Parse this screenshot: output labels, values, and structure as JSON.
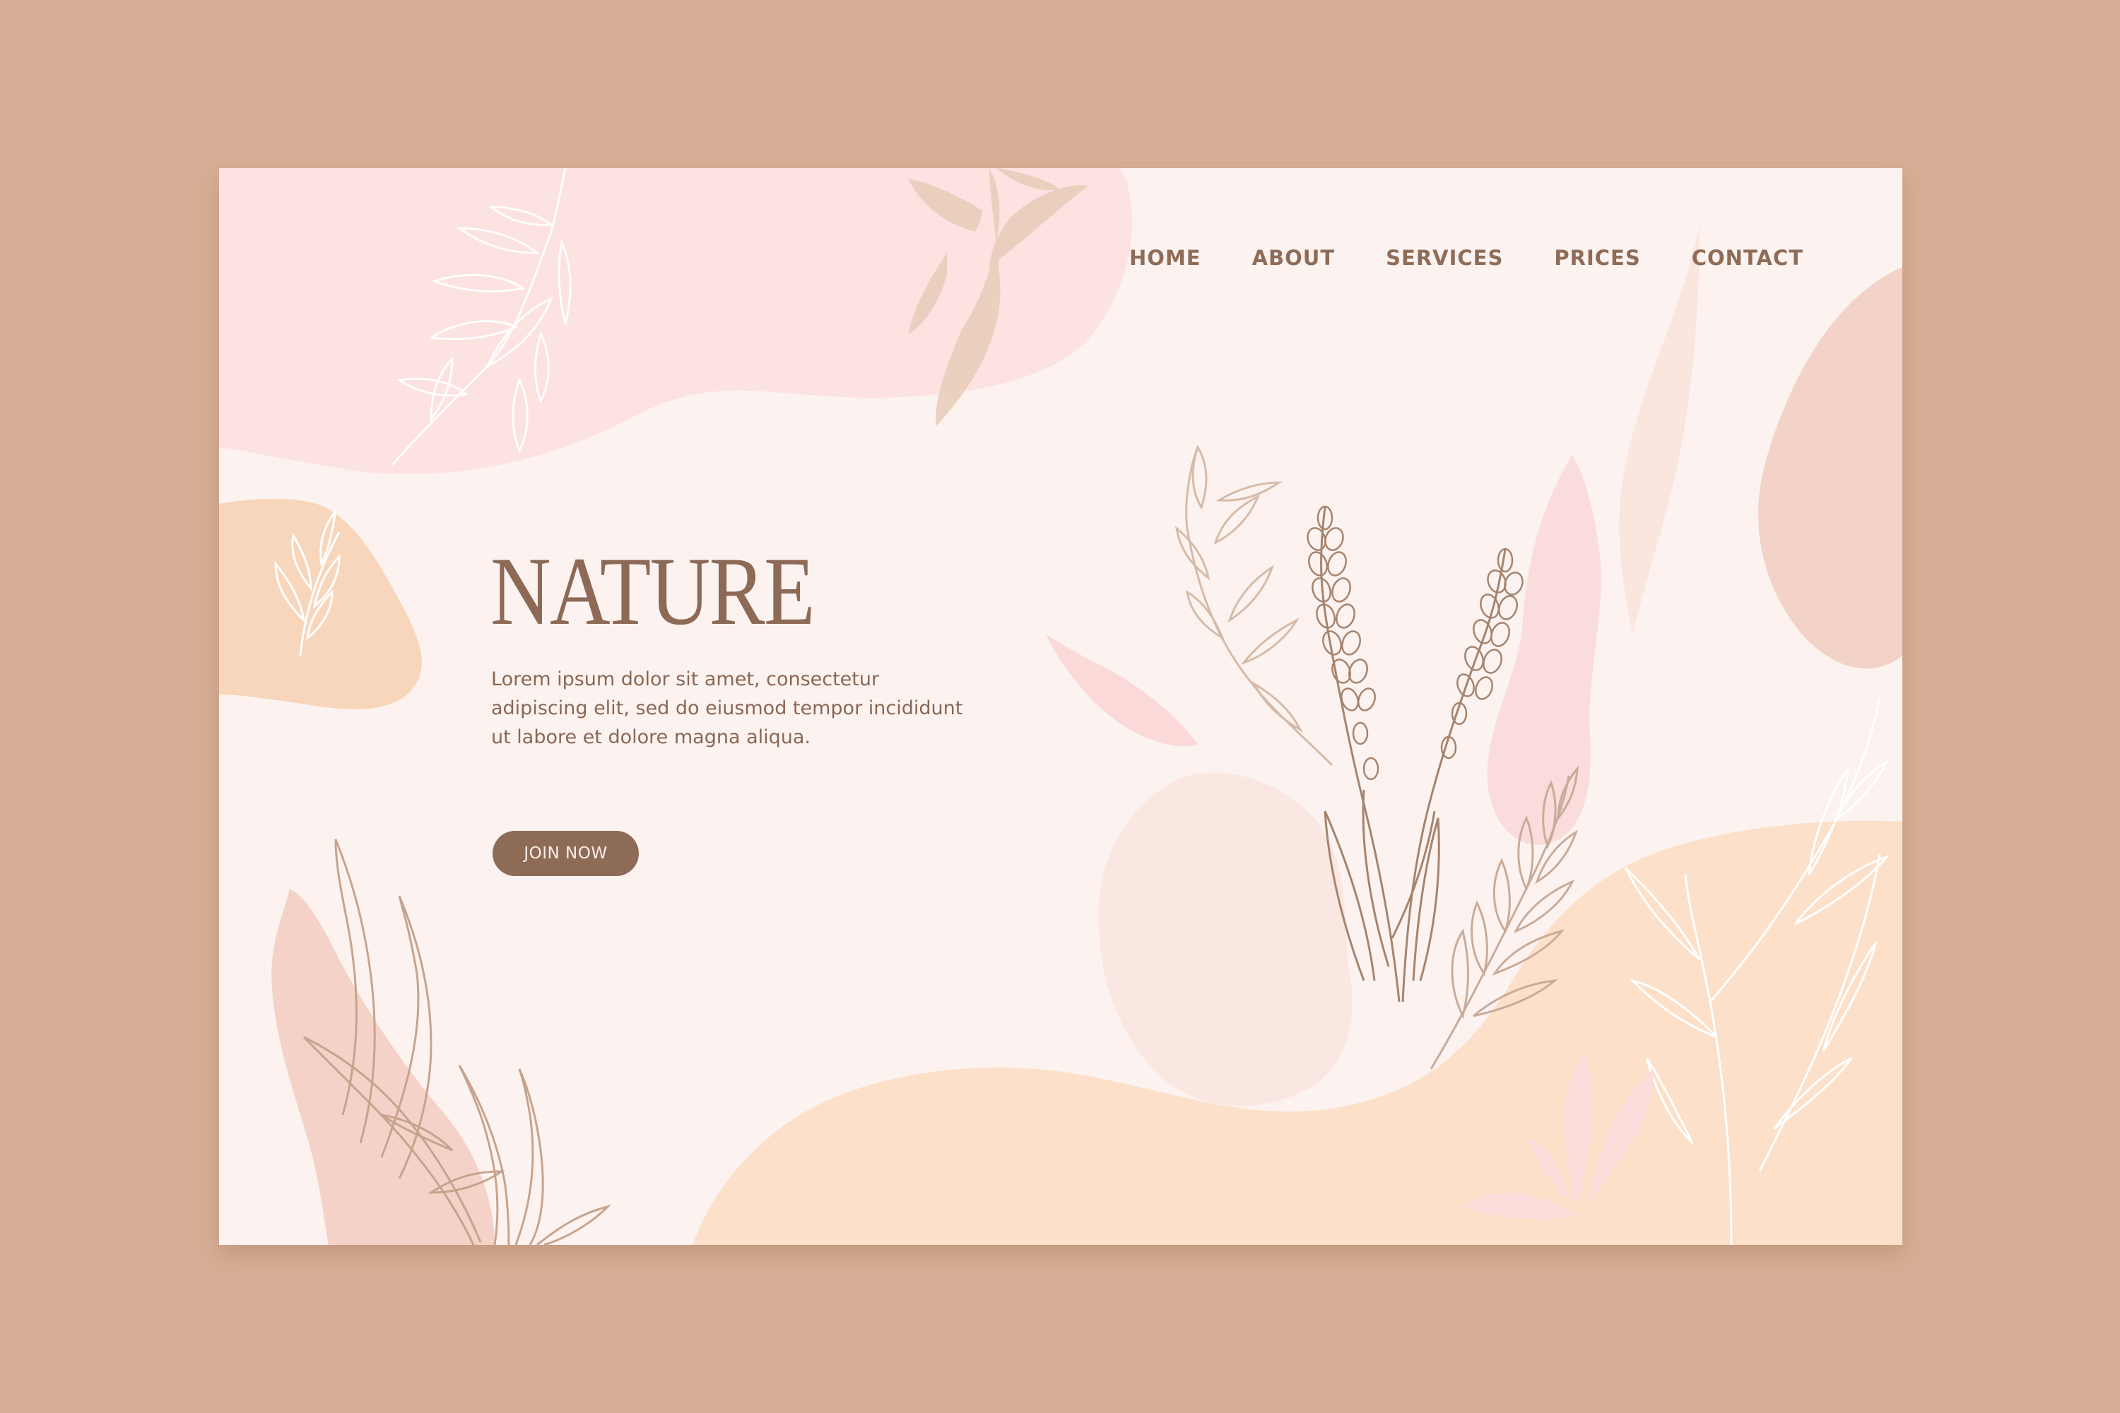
{
  "page": {
    "background_color": "#d7af96",
    "card_color": "#fcf3f0",
    "accent_color": "#8e6b57"
  },
  "nav": {
    "items": [
      {
        "label": "HOME"
      },
      {
        "label": "ABOUT"
      },
      {
        "label": "SERVICES"
      },
      {
        "label": "PRICES"
      },
      {
        "label": "CONTACT"
      }
    ]
  },
  "hero": {
    "title": "NATURE",
    "text_lines": [
      "Lorem ipsum dolor sit amet, consectetur",
      "adipiscing elit, sed do eiusmod tempor incididunt",
      "ut labore et dolore magna aliqua."
    ],
    "button_label": "JOIN NOW"
  },
  "decor": {
    "icons": [
      "leaf-branch-icon",
      "lavender-sprig-icon",
      "wildflower-sprig-icon",
      "abstract-blob-shape"
    ]
  }
}
